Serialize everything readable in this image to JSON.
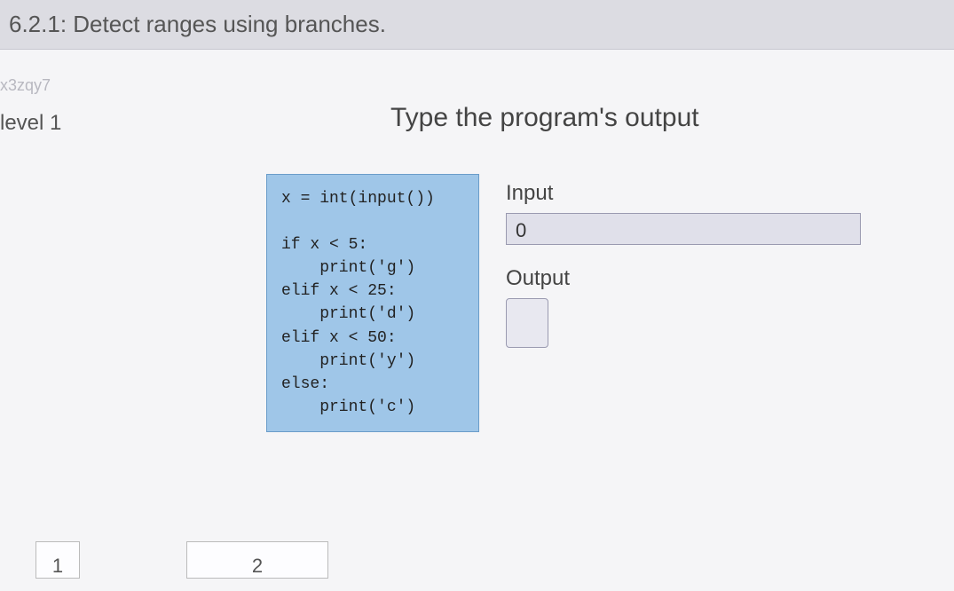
{
  "header": {
    "title": "6.2.1: Detect ranges using branches."
  },
  "watermark": "x3zqy7",
  "level_label": "level 1",
  "prompt": "Type the program's output",
  "code": "x = int(input())\n\nif x < 5:\n    print('g')\nelif x < 25:\n    print('d')\nelif x < 50:\n    print('y')\nelse:\n    print('c')",
  "io": {
    "input_label": "Input",
    "input_value": "0",
    "output_label": "Output",
    "output_value": ""
  },
  "nav": {
    "prev": "1",
    "next": "2"
  }
}
